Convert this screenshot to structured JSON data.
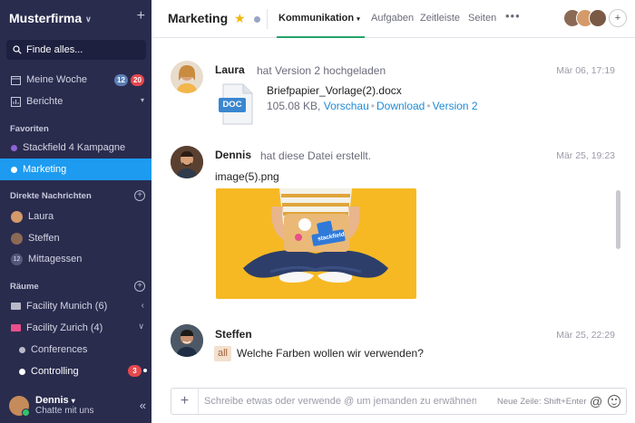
{
  "sidebar": {
    "workspace": "Musterfirma",
    "search_placeholder": "Finde alles...",
    "my_week": "Meine Woche",
    "my_week_badge_blue": "12",
    "my_week_badge_red": "20",
    "reports": "Berichte",
    "favorites_header": "Favoriten",
    "favorites": [
      "Stackfield 4 Kampagne",
      "Marketing"
    ],
    "dm_header": "Direkte Nachrichten",
    "dms": [
      "Laura",
      "Steffen",
      "Mittagessen"
    ],
    "dm_group_count": "12",
    "rooms_header": "Räume",
    "rooms": [
      "Facility Munich (6)",
      "Facility Zurich (4)",
      "Conferences",
      "Controlling"
    ],
    "controlling_badge": "3",
    "user_name": "Dennis",
    "user_status": "Chatte mit uns"
  },
  "header": {
    "title": "Marketing",
    "tabs": [
      "Kommunikation",
      "Aufgaben",
      "Zeitleiste",
      "Seiten"
    ],
    "more": "•••",
    "add_member": "+"
  },
  "messages": [
    {
      "author": "Laura",
      "action": "hat Version 2 hochgeladen",
      "time": "Mär 06, 17:19",
      "file_icon_label": "DOC",
      "file_name": "Briefpapier_Vorlage(2).docx",
      "file_size": "105.08 KB,",
      "links": [
        "Vorschau",
        "Download",
        "Version 2"
      ]
    },
    {
      "author": "Dennis",
      "action": "hat diese Datei erstellt.",
      "time": "Mär 25, 19:23",
      "file_name": "image(5).png",
      "sticker_text": "stackfield"
    },
    {
      "author": "Steffen",
      "time": "Mär 25, 22:29",
      "mention": "all",
      "text": "Welche Farben wollen wir verwenden?"
    }
  ],
  "composer": {
    "placeholder": "Schreibe etwas oder verwende @ um jemanden zu erwähnen",
    "hint": "Neue Zeile: Shift+Enter",
    "at": "@",
    "plus": "+"
  },
  "colors": {
    "sidebar_bg": "#2a2c4e",
    "active_item": "#1d9bf0",
    "link": "#1d8bd8",
    "tab_underline": "#27a36b",
    "badge_red": "#e5484d",
    "badge_blue": "#5b7fb5",
    "star": "#f2b705"
  }
}
